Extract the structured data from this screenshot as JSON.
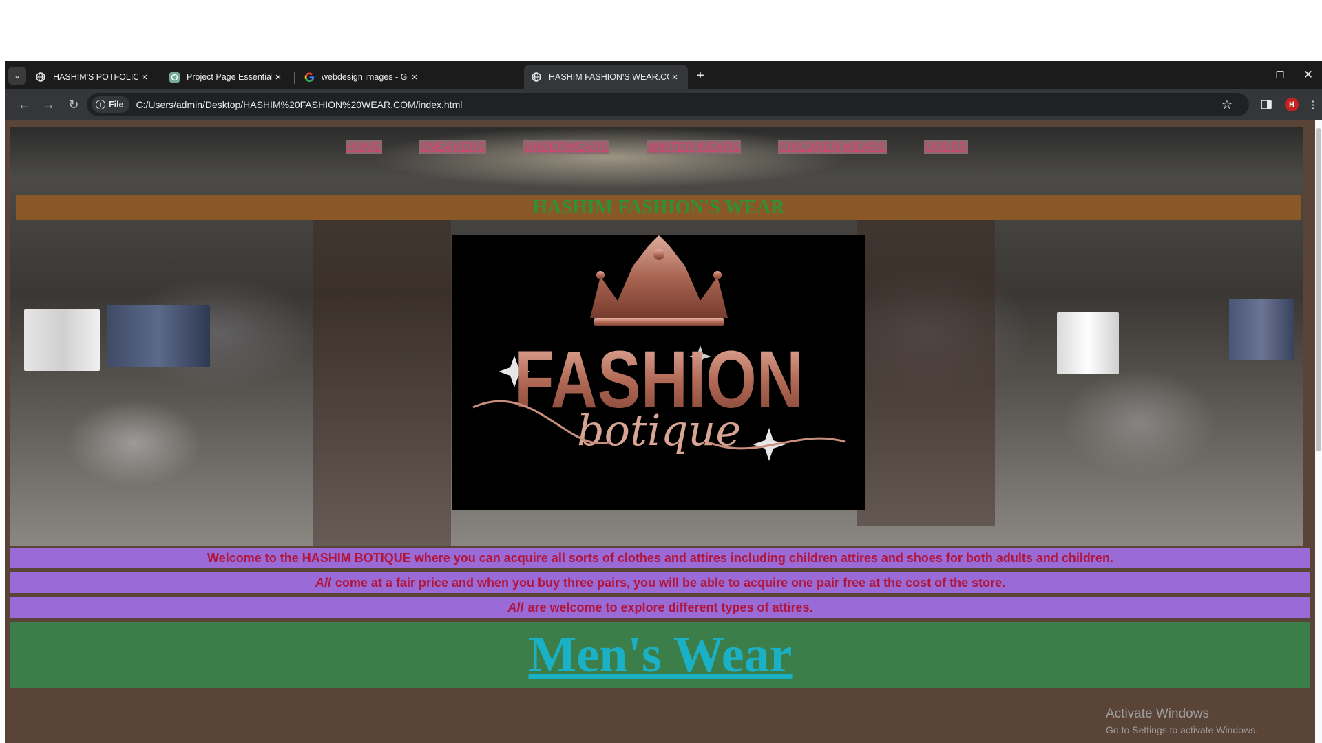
{
  "browser": {
    "tabs": [
      {
        "title": "HASHIM'S POTFOLIO WEBSITE",
        "favicon": "globe-icon"
      },
      {
        "title": "Project Page Essentials",
        "favicon": "chatgpt-icon"
      },
      {
        "title": "webdesign images - Google Se",
        "favicon": "google-icon"
      },
      {
        "title": "HASHIM FASHION'S WEAR.COM",
        "favicon": "globe-icon",
        "active": true
      }
    ],
    "chip_label": "File",
    "url": "C:/Users/admin/Desktop/HASHIM%20FASHION%20WEAR.COM/index.html",
    "profile_initial": "H"
  },
  "page": {
    "nav": [
      "HOME",
      "SNEAKERS",
      "UNDERWEARS",
      "WINTER WEARS",
      "CHILDREN WEARS",
      "ORDER"
    ],
    "brand_title": "HASHIM FASHION'S WEAR",
    "logo": {
      "line1": "FASHION",
      "line2": "botique"
    },
    "info": [
      {
        "em": "",
        "text": "Welcome to the HASHIM BOTIQUE where you can acquire all sorts of clothes and attires including children attires and shoes for both adults and children."
      },
      {
        "em": "All",
        "text": "come at a fair price and when you buy three pairs, you will be able to acquire one pair free at the cost of the store."
      },
      {
        "em": "All",
        "text": "are welcome to explore different types of attires."
      }
    ],
    "section_heading": "Men's Wear"
  },
  "overlay": {
    "activate_title": "Activate Windows",
    "activate_sub": "Go to Settings to activate Windows."
  },
  "colors": {
    "nav_link": "#c44b6a",
    "brand_bar": "#8a5726",
    "brand_text": "#2f9136",
    "info_bar": "#9a6ad6",
    "info_text": "#b1163a",
    "mens_bg": "#3c7e4a",
    "mens_text": "#1ab0c6"
  }
}
